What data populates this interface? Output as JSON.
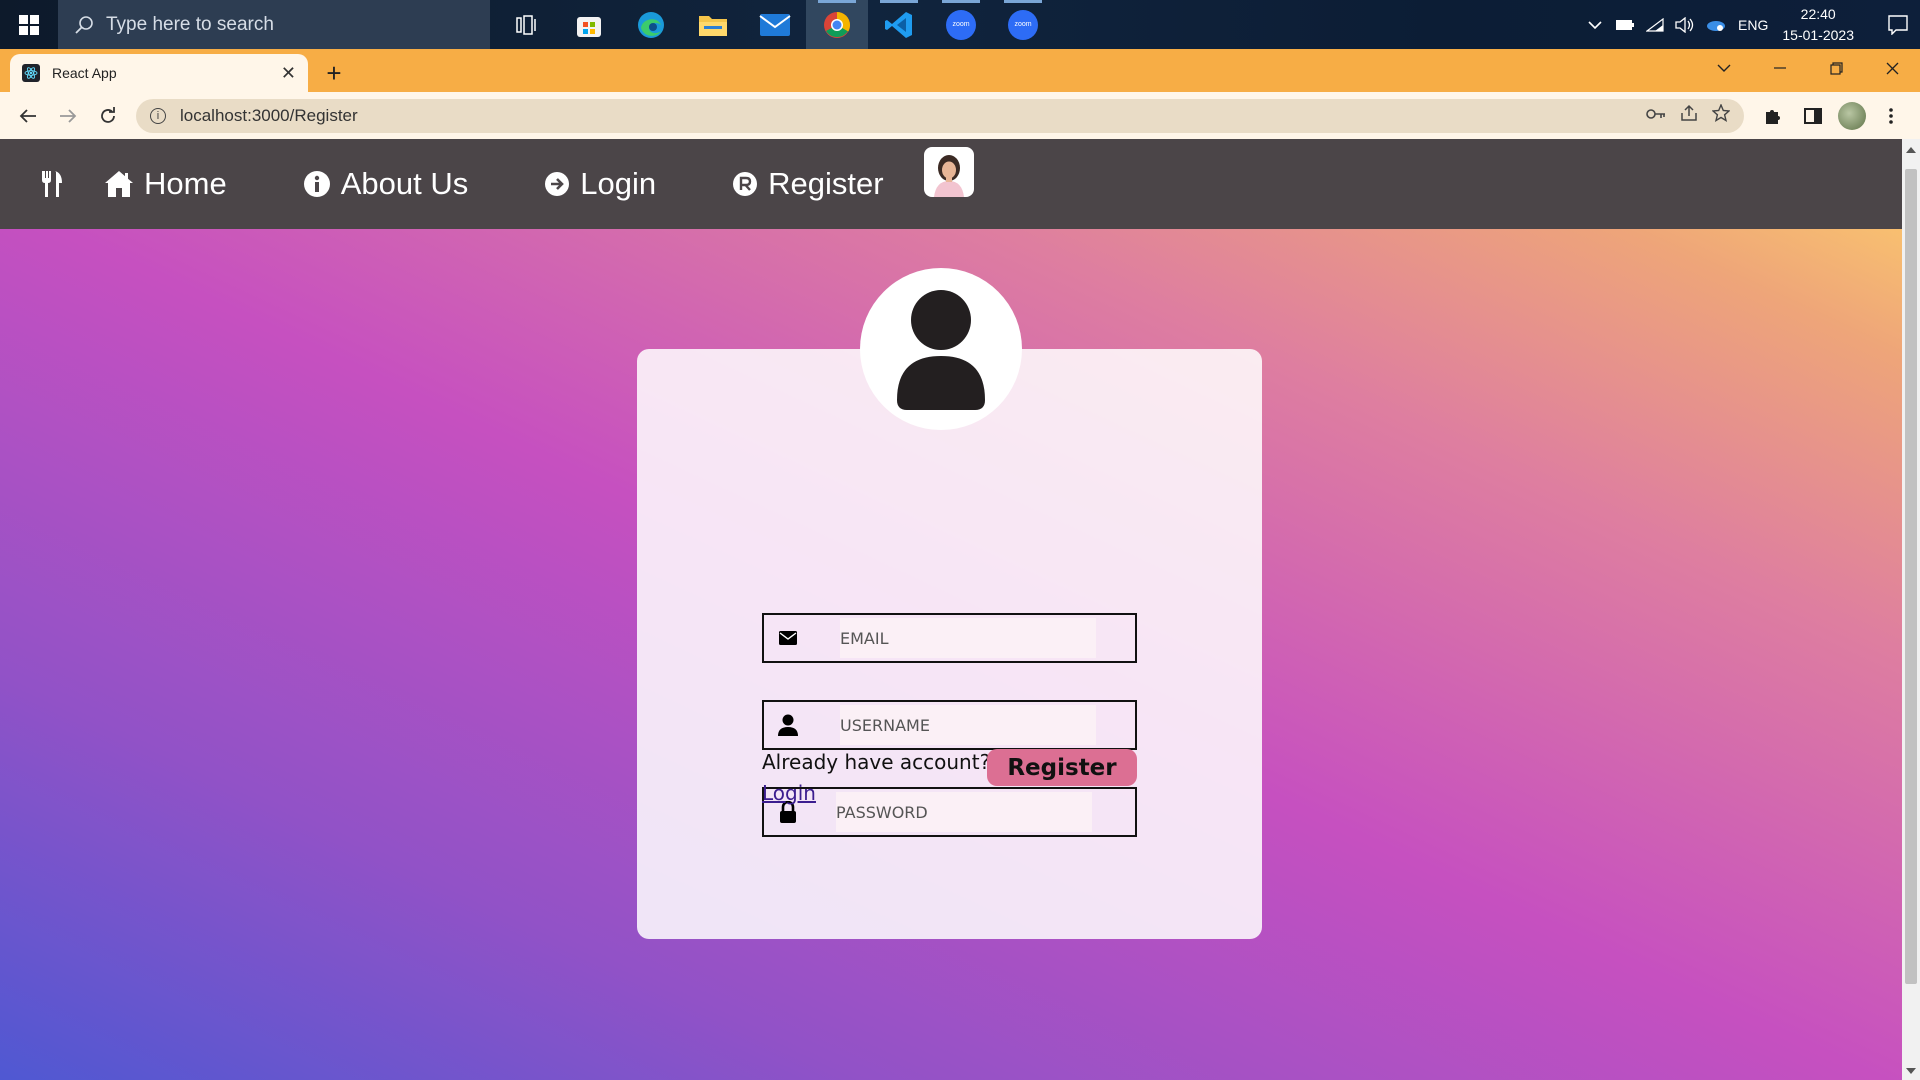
{
  "taskbar": {
    "search_placeholder": "Type here to search",
    "apps": [
      {
        "icon": "task-view-icon"
      },
      {
        "icon": "microsoft-store-icon"
      },
      {
        "icon": "edge-icon"
      },
      {
        "icon": "file-explorer-icon"
      },
      {
        "icon": "mail-icon"
      },
      {
        "icon": "chrome-icon"
      },
      {
        "icon": "vscode-icon"
      },
      {
        "icon": "zoom-icon",
        "label": "zoom"
      },
      {
        "icon": "zoom-icon",
        "label": "zoom"
      }
    ],
    "language": "ENG",
    "time": "22:40",
    "date": "15-01-2023"
  },
  "browser": {
    "tab_title": "React App",
    "url": "localhost:3000/Register"
  },
  "navbar": {
    "links": [
      {
        "label": "Home",
        "icon": "home-icon"
      },
      {
        "label": "About Us",
        "icon": "info-icon"
      },
      {
        "label": "Login",
        "icon": "arrow-circle-right-icon"
      },
      {
        "label": "Register",
        "icon": "registered-icon"
      }
    ]
  },
  "form": {
    "email_placeholder": "EMAIL",
    "username_placeholder": "USERNAME",
    "password_placeholder": "PASSWORD",
    "already_text": "Already have account?",
    "login_link": "Login",
    "register_button": "Register"
  },
  "colors": {
    "navbar_bg": "#4b4548",
    "register_button": "#dc6f93",
    "chrome_accent": "#f7ad45"
  }
}
